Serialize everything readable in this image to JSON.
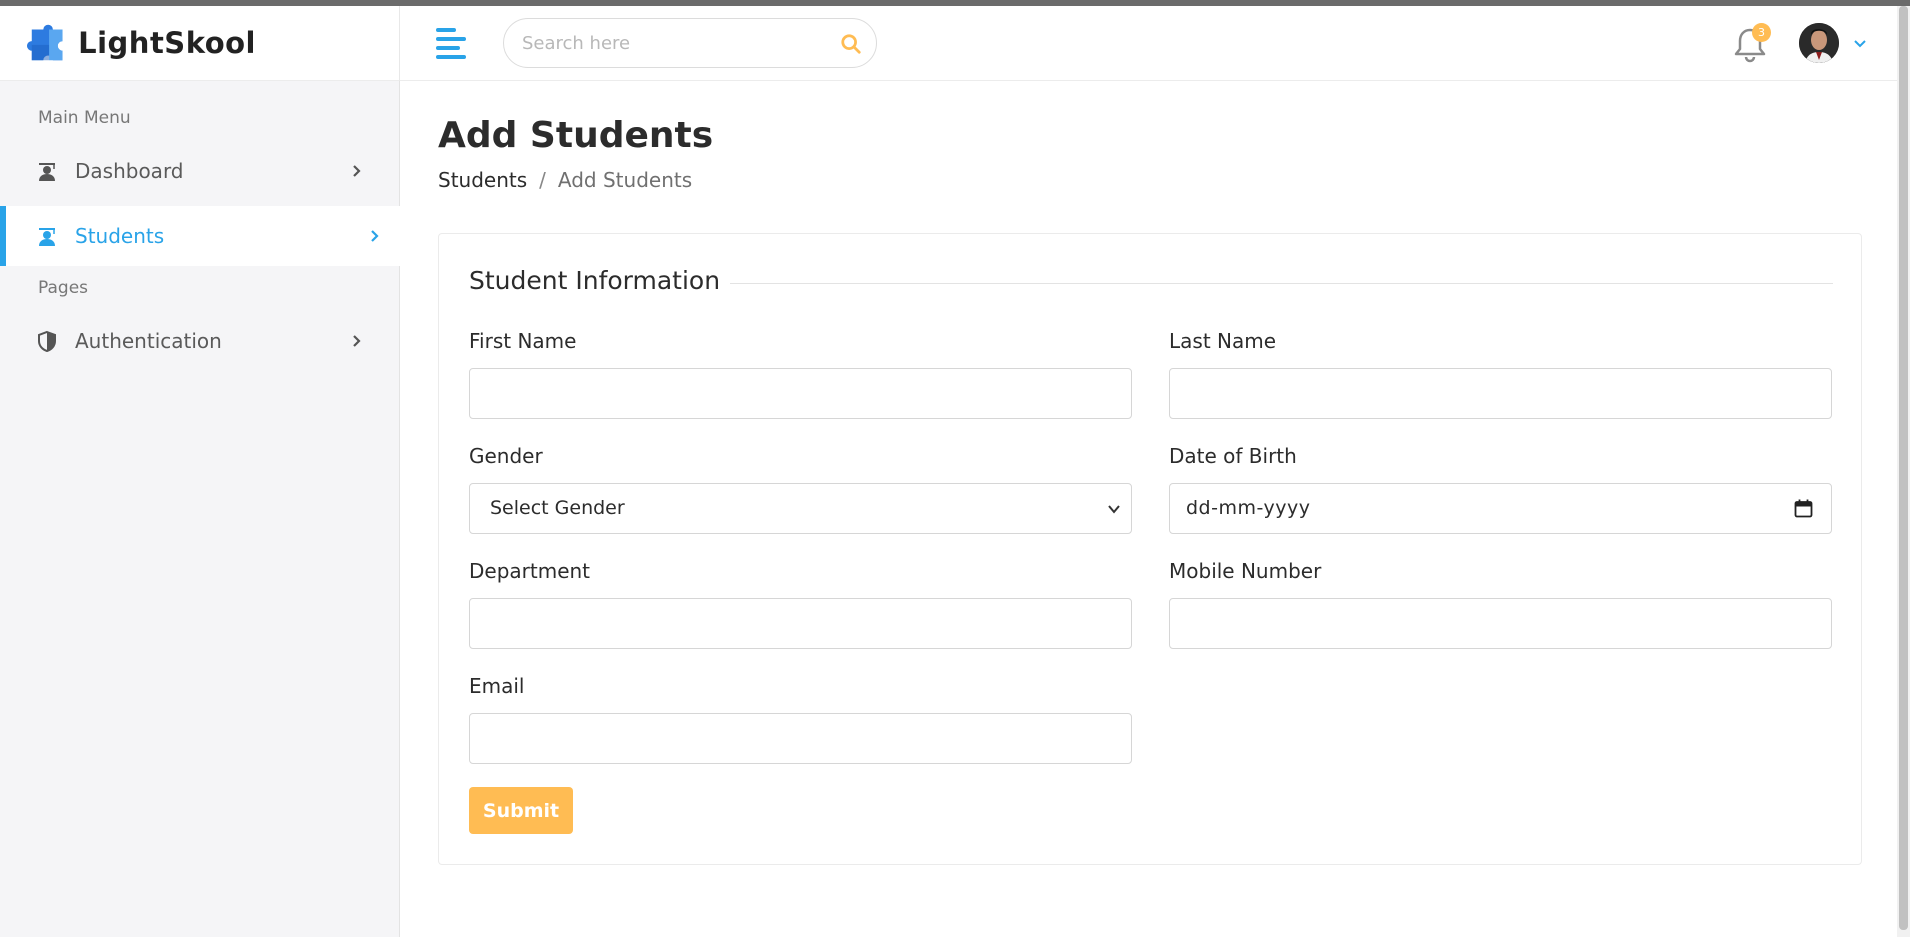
{
  "header": {
    "logo_text": "LightSkool",
    "search_placeholder": "Search here",
    "notification_count": "3"
  },
  "sidebar": {
    "main_menu_heading": "Main Menu",
    "pages_heading": "Pages",
    "items": [
      {
        "label": "Dashboard",
        "icon": "graduate-icon"
      },
      {
        "label": "Students",
        "icon": "graduate-icon",
        "active": true
      },
      {
        "label": "Authentication",
        "icon": "shield-icon"
      }
    ]
  },
  "main": {
    "page_title": "Add Students",
    "breadcrumb": {
      "parent": "Students",
      "separator": "/",
      "current": "Add Students"
    }
  },
  "form": {
    "section_title": "Student Information",
    "first_name_label": "First Name",
    "last_name_label": "Last Name",
    "gender_label": "Gender",
    "gender_value": "Select Gender",
    "dob_label": "Date of Birth",
    "dob_value": "dd-mm-yyyy",
    "department_label": "Department",
    "mobile_label": "Mobile Number",
    "email_label": "Email",
    "submit_label": "Submit"
  },
  "colors": {
    "accent_blue": "#29a3e8",
    "accent_orange": "#ffbc53",
    "sidebar_bg": "#f5f5f7"
  }
}
